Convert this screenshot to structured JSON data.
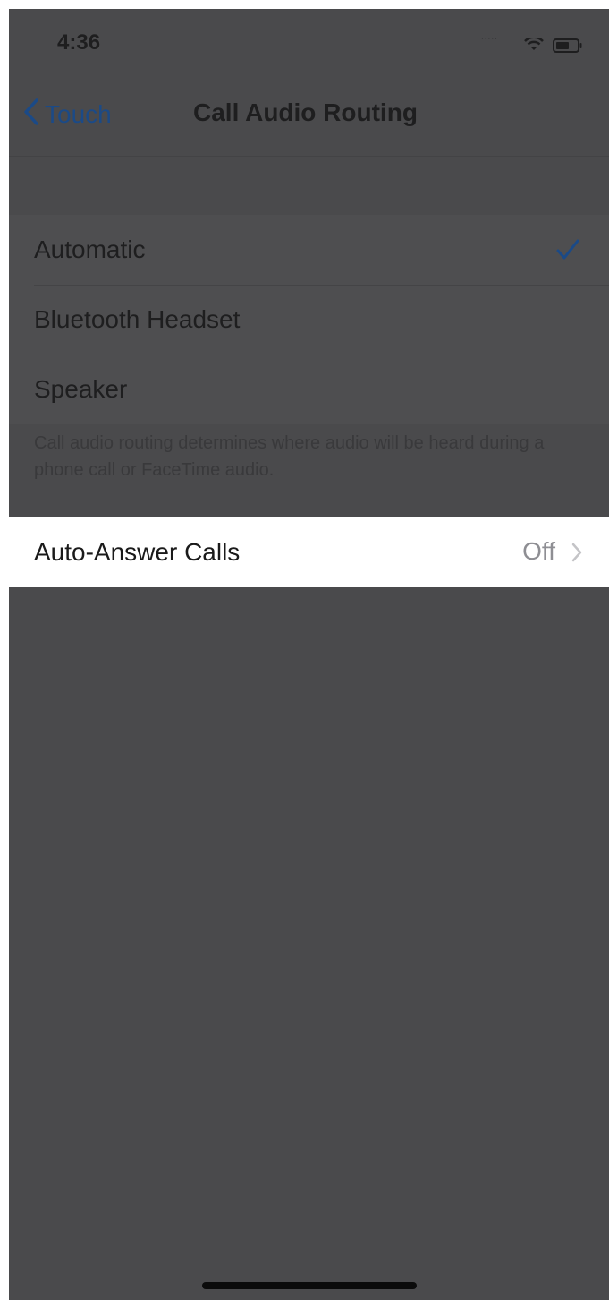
{
  "status_bar": {
    "time": "4:36",
    "signal_dots": "....."
  },
  "nav": {
    "back_label": "Touch",
    "title": "Call Audio Routing"
  },
  "routing_options": [
    {
      "label": "Automatic",
      "selected": true
    },
    {
      "label": "Bluetooth Headset",
      "selected": false
    },
    {
      "label": "Speaker",
      "selected": false
    }
  ],
  "footer_note": "Call audio routing determines where audio will be heard during a phone call or FaceTime audio.",
  "auto_answer": {
    "label": "Auto-Answer Calls",
    "value": "Off"
  },
  "colors": {
    "accent": "#1b4a87",
    "overlay": "#4a4a4c",
    "highlight": "#ffffff"
  }
}
